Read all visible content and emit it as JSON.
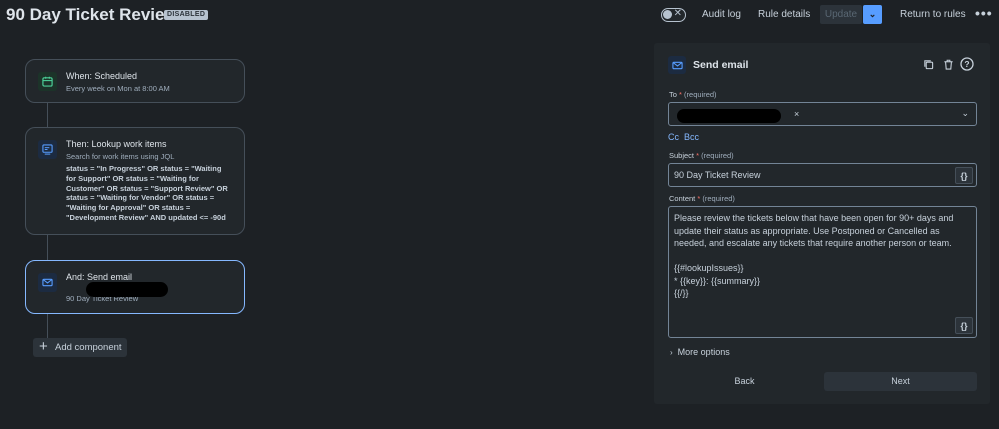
{
  "header": {
    "title": "90 Day Ticket Review",
    "status": "DISABLED",
    "actions": {
      "audit_log": "Audit log",
      "rule_details": "Rule details",
      "update": "Update",
      "return": "Return to rules",
      "more": "•••"
    },
    "toggle_on": false
  },
  "canvas": {
    "trigger": {
      "title": "When: Scheduled",
      "subtitle": "Every week on Mon at 8:00 AM",
      "icon": "calendar-icon"
    },
    "lookup": {
      "title": "Then: Lookup work items",
      "subtitle": "Search for work items using JQL",
      "jql": "status = \"In Progress\" OR status = \"Waiting for Support\" OR status = \"Waiting for Customer\" OR status = \"Support Review\" OR status = \"Waiting for Vendor\" OR status = \"Waiting for Approval\" OR status = \"Development Review\" AND updated <= -90d",
      "icon": "search-list-icon"
    },
    "email": {
      "title": "And: Send email",
      "subtitle": "90 Day Ticket Review",
      "icon": "email-icon"
    },
    "add_component": "Add component"
  },
  "panel": {
    "title": "Send email",
    "icons": [
      "duplicate-icon",
      "delete-icon",
      "help-icon"
    ],
    "to": {
      "label": "To",
      "required": "(required)",
      "chip_remove": "×"
    },
    "cc": "Cc",
    "bcc": "Bcc",
    "subject": {
      "label": "Subject",
      "required": "(required)",
      "value": "90 Day Ticket Review"
    },
    "content": {
      "label": "Content",
      "required": "(required)",
      "value": "Please review the tickets below that have been open for 90+ days and update their status as appropriate. Use Postponed or Cancelled as needed, and escalate any tickets that require another person or team.\n\n{{#lookupIssues}}\n* {{key}}: {{summary}}\n{{/}}"
    },
    "smart_values": "{}",
    "more_options": "More options",
    "back": "Back",
    "next": "Next"
  },
  "colors": {
    "background": "#1d2125",
    "accent": "#579dff",
    "selected_border": "#85b8ff",
    "required": "#f87168"
  }
}
